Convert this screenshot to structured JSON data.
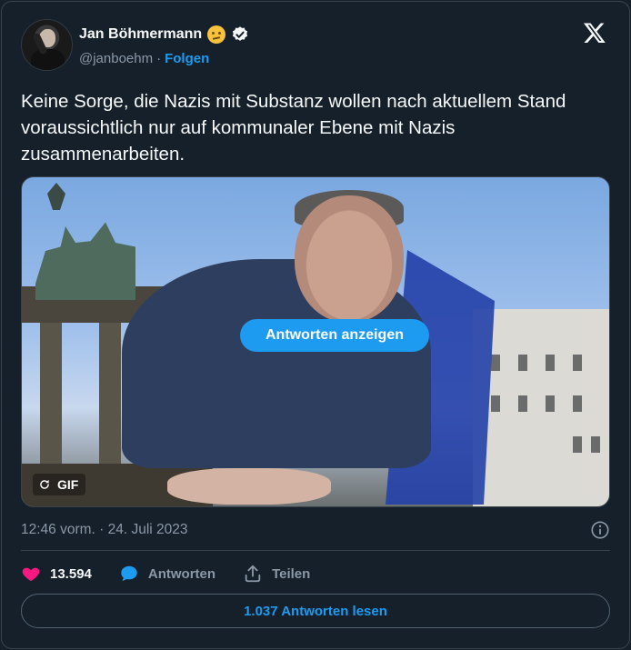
{
  "author": {
    "name": "Jan Böhmermann",
    "handle": "@janboehm",
    "separator": "·",
    "follow_label": "Folgen"
  },
  "tweet": {
    "text": "Keine Sorge, die Nazis mit Substanz wollen nach aktuellem Stand voraussichtlich nur auf kommunaler Ebene mit Nazis zusammenarbeiten.",
    "timestamp": "12:46 vorm. · 24. Juli 2023"
  },
  "media": {
    "reply_button_label": "Antworten anzeigen",
    "gif_label": "GIF"
  },
  "actions": {
    "like_count": "13.594",
    "reply_label": "Antworten",
    "share_label": "Teilen"
  },
  "read_replies_label": "1.037 Antworten lesen",
  "icons": {
    "brand": "x-logo-icon",
    "verified": "verified-badge-icon",
    "like": "heart-icon",
    "reply": "speech-bubble-icon",
    "share": "share-icon",
    "info": "info-icon",
    "replay": "replay-icon"
  },
  "colors": {
    "background": "#15202b",
    "accent": "#1d9bf0",
    "like": "#f91880",
    "muted": "#8b98a5",
    "border": "#38444d"
  }
}
